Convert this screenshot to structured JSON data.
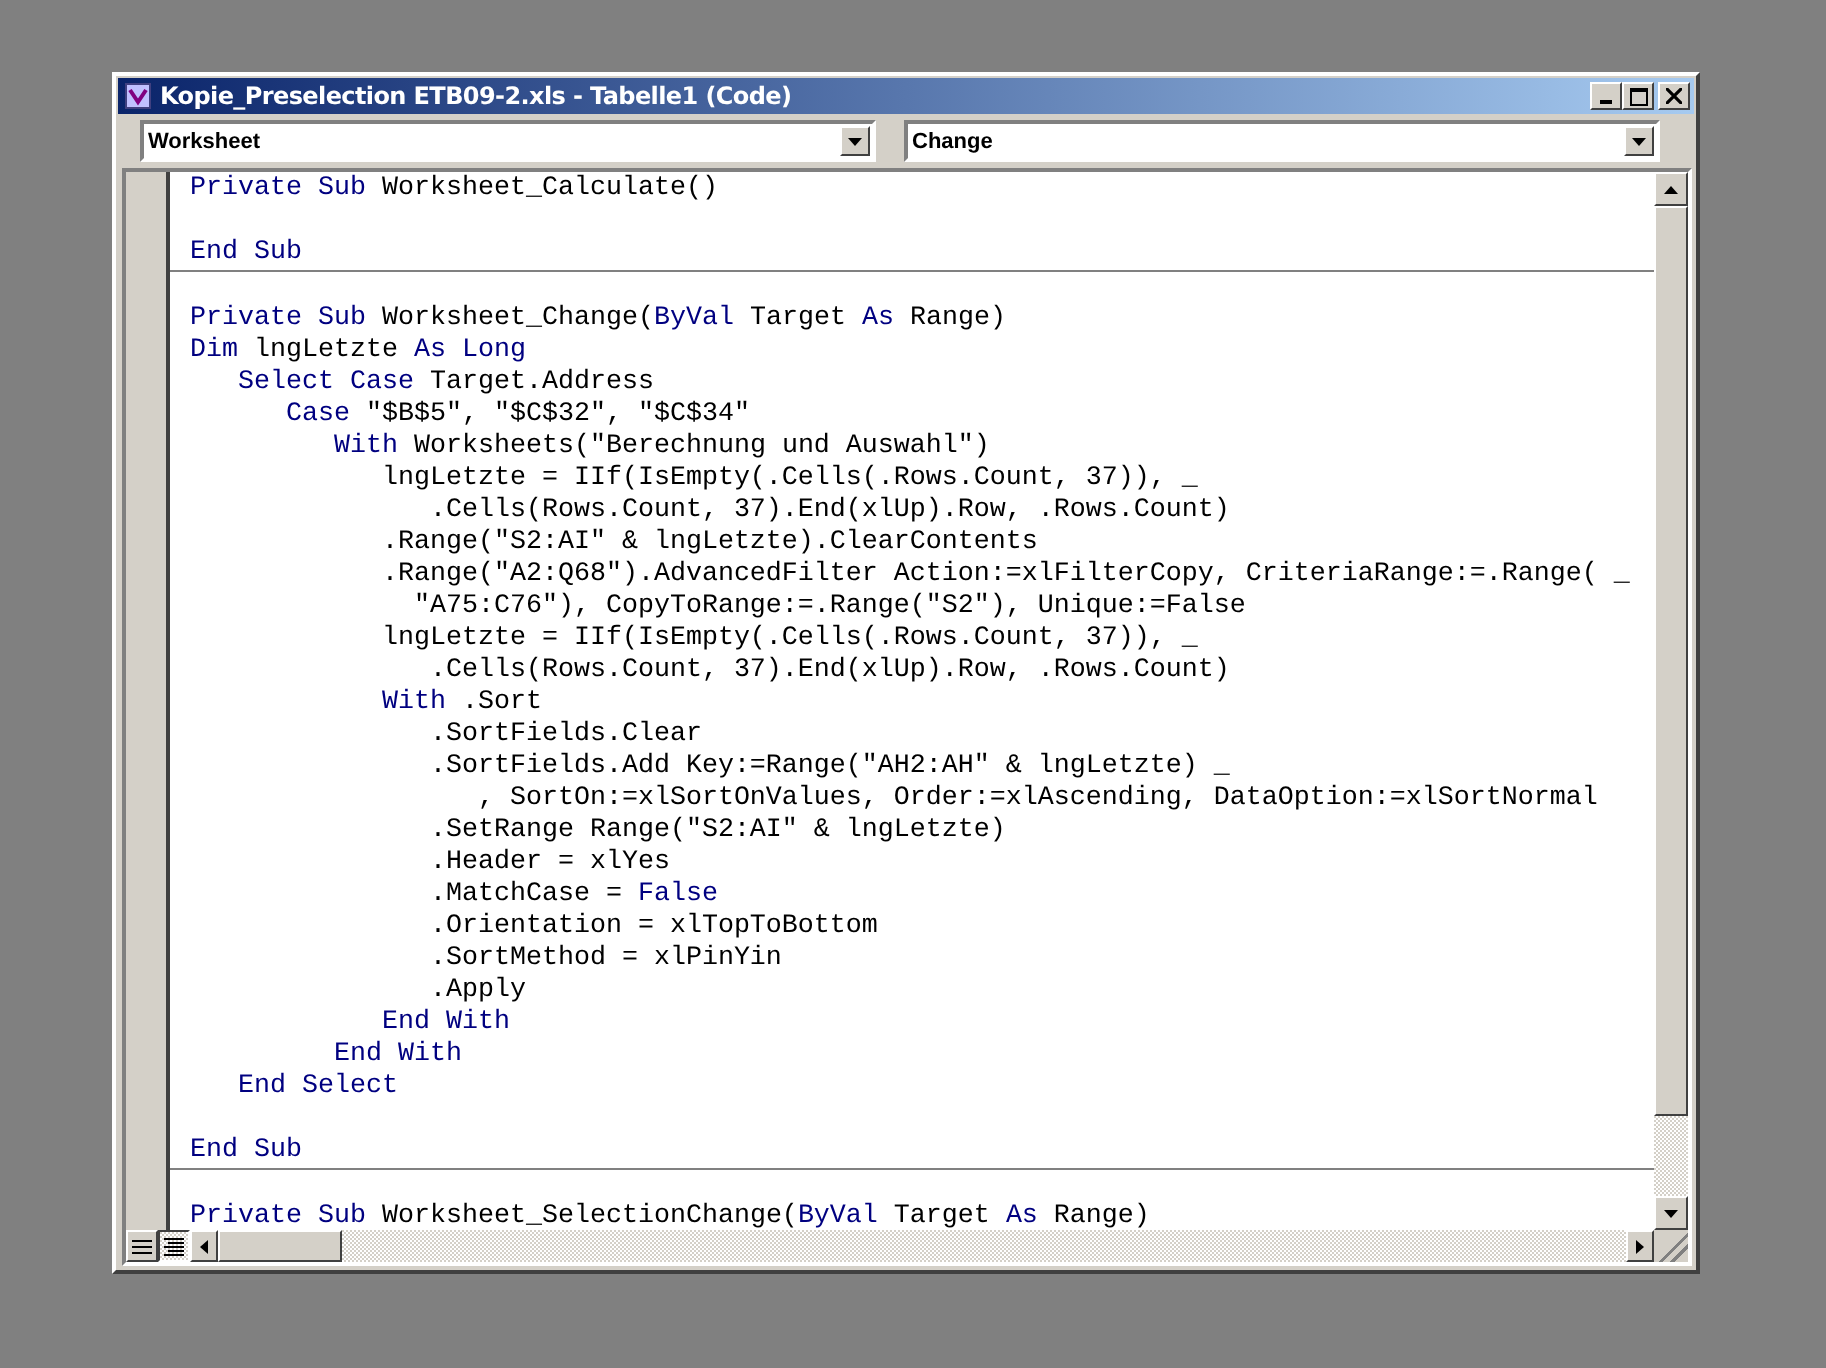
{
  "window": {
    "title": "Kopie_Preselection ETB09-2.xls - Tabelle1 (Code)"
  },
  "object_box": {
    "value": "Worksheet"
  },
  "procedure_box": {
    "value": "Change"
  },
  "procedures": [
    {
      "lines": [
        {
          "kind": "code",
          "segments": [
            {
              "text": "Private Sub",
              "kind": "keyword"
            },
            {
              "text": " Worksheet_Calculate()",
              "kind": "plain"
            }
          ]
        },
        {
          "kind": "blank"
        },
        {
          "kind": "code",
          "segments": [
            {
              "text": "End Sub",
              "kind": "keyword"
            }
          ]
        }
      ]
    },
    {
      "lines": [
        {
          "kind": "blank"
        },
        {
          "kind": "code",
          "segments": [
            {
              "text": "Private Sub",
              "kind": "keyword"
            },
            {
              "text": " Worksheet_Change(",
              "kind": "plain"
            },
            {
              "text": "ByVal",
              "kind": "keyword"
            },
            {
              "text": " Target ",
              "kind": "plain"
            },
            {
              "text": "As",
              "kind": "keyword"
            },
            {
              "text": " Range)",
              "kind": "plain"
            }
          ]
        },
        {
          "kind": "code",
          "segments": [
            {
              "text": "Dim",
              "kind": "keyword"
            },
            {
              "text": " lngLetzte ",
              "kind": "plain"
            },
            {
              "text": "As Long",
              "kind": "keyword"
            }
          ]
        },
        {
          "kind": "code",
          "segments": [
            {
              "text": "   Select Case",
              "kind": "keyword"
            },
            {
              "text": " Target.Address",
              "kind": "plain"
            }
          ]
        },
        {
          "kind": "code",
          "segments": [
            {
              "text": "      Case",
              "kind": "keyword"
            },
            {
              "text": " \"$B$5\", \"$C$32\", \"$C$34\"",
              "kind": "plain"
            }
          ]
        },
        {
          "kind": "code",
          "segments": [
            {
              "text": "         With",
              "kind": "keyword"
            },
            {
              "text": " Worksheets(\"Berechnung und Auswahl\")",
              "kind": "plain"
            }
          ]
        },
        {
          "kind": "code",
          "segments": [
            {
              "text": "            lngLetzte = IIf(IsEmpty(.Cells(.Rows.Count, 37)), _",
              "kind": "plain"
            }
          ]
        },
        {
          "kind": "code",
          "segments": [
            {
              "text": "               .Cells(Rows.Count, 37).End(xlUp).Row, .Rows.Count)",
              "kind": "plain"
            }
          ]
        },
        {
          "kind": "code",
          "segments": [
            {
              "text": "            .Range(\"S2:AI\" & lngLetzte).ClearContents",
              "kind": "plain"
            }
          ]
        },
        {
          "kind": "code",
          "segments": [
            {
              "text": "            .Range(\"A2:Q68\").AdvancedFilter Action:=xlFilterCopy, CriteriaRange:=.Range( _",
              "kind": "plain"
            }
          ]
        },
        {
          "kind": "code",
          "segments": [
            {
              "text": "              \"A75:C76\"), CopyToRange:=.Range(\"S2\"), Unique:=False",
              "kind": "plain"
            }
          ]
        },
        {
          "kind": "code",
          "segments": [
            {
              "text": "            lngLetzte = IIf(IsEmpty(.Cells(.Rows.Count, 37)), _",
              "kind": "plain"
            }
          ]
        },
        {
          "kind": "code",
          "segments": [
            {
              "text": "               .Cells(Rows.Count, 37).End(xlUp).Row, .Rows.Count)",
              "kind": "plain"
            }
          ]
        },
        {
          "kind": "code",
          "segments": [
            {
              "text": "            With",
              "kind": "keyword"
            },
            {
              "text": " .Sort",
              "kind": "plain"
            }
          ]
        },
        {
          "kind": "code",
          "segments": [
            {
              "text": "               .SortFields.Clear",
              "kind": "plain"
            }
          ]
        },
        {
          "kind": "code",
          "segments": [
            {
              "text": "               .SortFields.Add Key:=Range(\"AH2:AH\" & lngLetzte) _",
              "kind": "plain"
            }
          ]
        },
        {
          "kind": "code",
          "segments": [
            {
              "text": "                  , SortOn:=xlSortOnValues, Order:=xlAscending, DataOption:=xlSortNormal",
              "kind": "plain"
            }
          ]
        },
        {
          "kind": "code",
          "segments": [
            {
              "text": "               .SetRange Range(\"S2:AI\" & lngLetzte)",
              "kind": "plain"
            }
          ]
        },
        {
          "kind": "code",
          "segments": [
            {
              "text": "               .Header = xlYes",
              "kind": "plain"
            }
          ]
        },
        {
          "kind": "code",
          "segments": [
            {
              "text": "               .MatchCase = ",
              "kind": "plain"
            },
            {
              "text": "False",
              "kind": "keyword"
            }
          ]
        },
        {
          "kind": "code",
          "segments": [
            {
              "text": "               .Orientation = xlTopToBottom",
              "kind": "plain"
            }
          ]
        },
        {
          "kind": "code",
          "segments": [
            {
              "text": "               .SortMethod = xlPinYin",
              "kind": "plain"
            }
          ]
        },
        {
          "kind": "code",
          "segments": [
            {
              "text": "               .Apply",
              "kind": "plain"
            }
          ]
        },
        {
          "kind": "code",
          "segments": [
            {
              "text": "            End With",
              "kind": "keyword"
            }
          ]
        },
        {
          "kind": "code",
          "segments": [
            {
              "text": "         End With",
              "kind": "keyword"
            }
          ]
        },
        {
          "kind": "code",
          "segments": [
            {
              "text": "   End Select",
              "kind": "keyword"
            }
          ]
        },
        {
          "kind": "blank"
        },
        {
          "kind": "code",
          "segments": [
            {
              "text": "End Sub",
              "kind": "keyword"
            }
          ]
        }
      ]
    },
    {
      "lines": [
        {
          "kind": "blank"
        },
        {
          "kind": "code",
          "segments": [
            {
              "text": "Private Sub",
              "kind": "keyword"
            },
            {
              "text": " Worksheet_SelectionChange(",
              "kind": "plain"
            },
            {
              "text": "ByVal",
              "kind": "keyword"
            },
            {
              "text": " Target ",
              "kind": "plain"
            },
            {
              "text": "As",
              "kind": "keyword"
            },
            {
              "text": " Range)",
              "kind": "plain"
            }
          ]
        }
      ]
    }
  ],
  "view_buttons": [
    {
      "selected": false
    },
    {
      "selected": true
    }
  ]
}
